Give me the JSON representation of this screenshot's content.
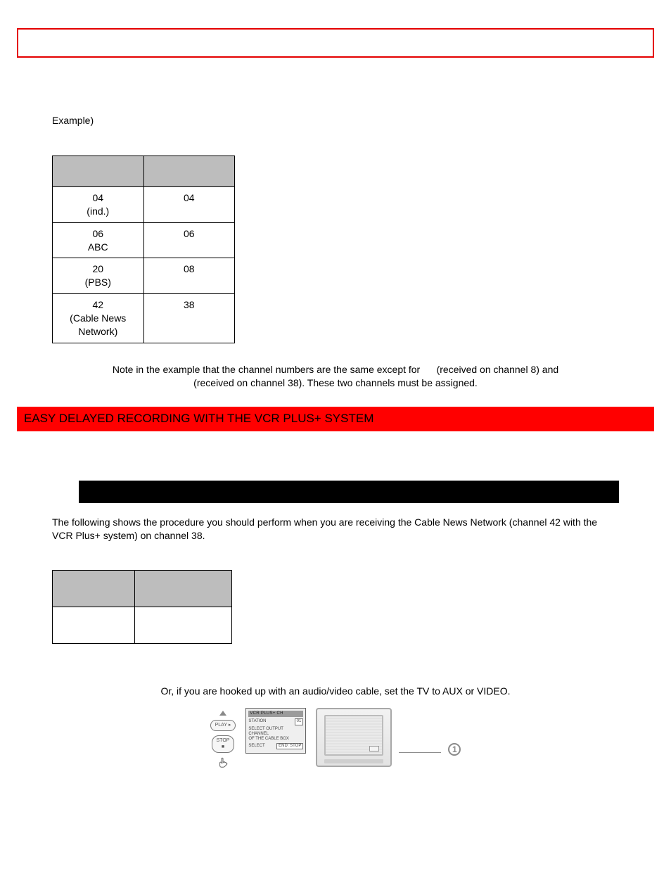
{
  "example_label": "Example)",
  "table1": {
    "rows": [
      {
        "a1": "04",
        "a2": "(ind.)",
        "b": "04"
      },
      {
        "a1": "06",
        "a2": "ABC",
        "b": "06"
      },
      {
        "a1": "20",
        "a2": "(PBS)",
        "b": "08"
      },
      {
        "a1": "42",
        "a2": "(Cable News",
        "a3": "Network)",
        "b": "38"
      }
    ]
  },
  "note_line1_a": "Note in the example that the channel numbers are the same except for",
  "note_line1_b": "(received on channel 8) and",
  "note_line2": "(received on channel 38). These two channels must be assigned.",
  "red_bar": "EASY DELAYED RECORDING WITH THE VCR PLUS+ SYSTEM",
  "proc_text": "The following shows the procedure you should perform when you are receiving the Cable News Network (channel 42 with the VCR Plus+ system) on channel 38.",
  "aux_note": "Or, if you are hooked up with an audio/video cable, set the TV to AUX or VIDEO.",
  "remote": {
    "play": "PLAY",
    "stop": "STOP"
  },
  "osd": {
    "title": "VCR PLUS+ CH",
    "row1_label": "STATION",
    "row1_val": "01",
    "desc1": "SELECT OUTPUT CHANNEL",
    "desc2": "OF THE CABLE BOX",
    "row2_label": "SELECT",
    "row2_val": "END: STOP"
  },
  "callout": "1"
}
